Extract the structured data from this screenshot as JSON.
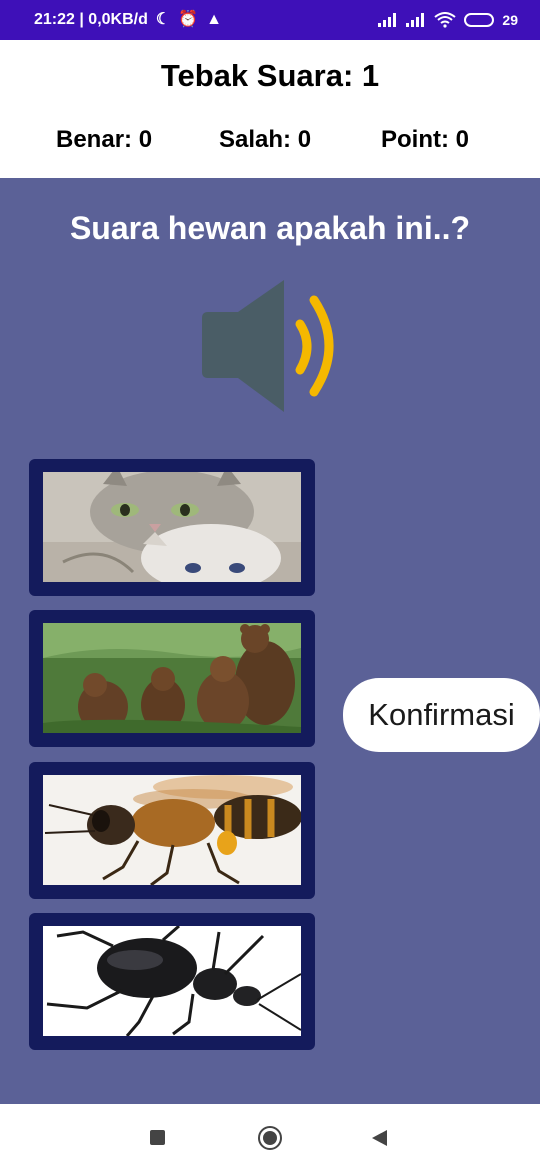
{
  "status_bar": {
    "time_info": "21:22 | 0,0KB/d",
    "battery_percent": "29",
    "icons": [
      "moon-icon",
      "alarm-icon",
      "warning-icon",
      "signal-icon",
      "signal-icon",
      "wifi-icon",
      "battery-icon"
    ]
  },
  "header": {
    "title": "Tebak Suara: 1",
    "benar": "Benar: 0",
    "salah": "Salah: 0",
    "point": "Point: 0"
  },
  "main": {
    "question": "Suara hewan apakah ini..?",
    "speaker_icon": "speaker-icon",
    "choices": [
      {
        "animal": "cat",
        "icon": "cat-image"
      },
      {
        "animal": "bear",
        "icon": "bear-image"
      },
      {
        "animal": "bee",
        "icon": "bee-image"
      },
      {
        "animal": "beetle",
        "icon": "beetle-image"
      }
    ],
    "confirm_label": "Konfirmasi"
  },
  "colors": {
    "status_bar": "#3e10b8",
    "background": "#5b6197",
    "choice_frame": "#141b5c",
    "speaker_body": "#4a5d66",
    "speaker_waves": "#f5b800"
  }
}
